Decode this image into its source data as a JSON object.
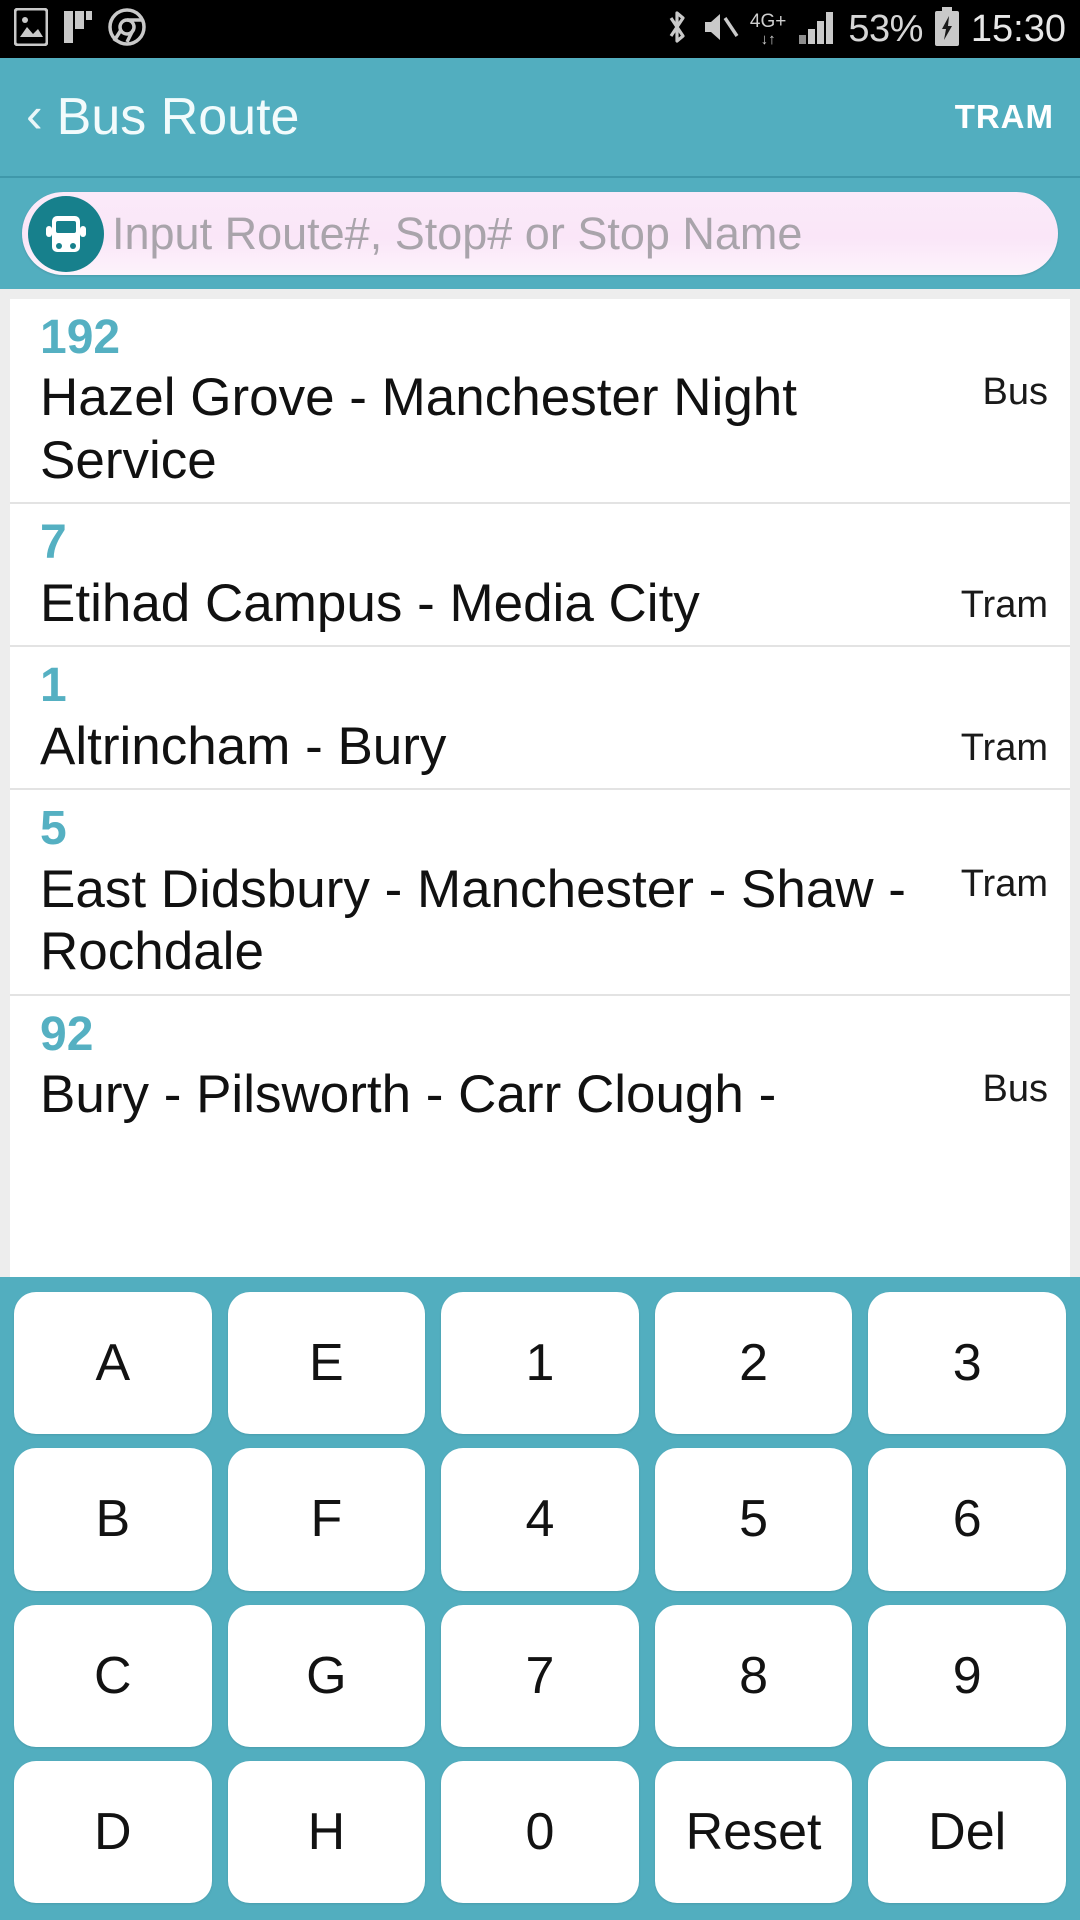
{
  "statusbar": {
    "icons_left": [
      "photo-icon",
      "flipboard-icon",
      "chrome-icon"
    ],
    "icons_right": [
      "bluetooth-icon",
      "mute-icon",
      "mobile-data-icon",
      "signal-icon",
      "battery-icon"
    ],
    "network_label": "4G+",
    "network_arrows": "↓↑",
    "battery_percent": "53%",
    "clock": "15:30"
  },
  "appbar": {
    "back_label": "‹",
    "title": "Bus Route",
    "action_label": "TRAM",
    "background": "#52aebf"
  },
  "search": {
    "icon": "bus-icon",
    "placeholder": "Input Route#, Stop# or Stop Name",
    "value": "",
    "background": "#fae6f8",
    "icon_background": "#17808c"
  },
  "routes": {
    "accent_color": "#55b0c2",
    "items": [
      {
        "number": "192",
        "name": "Hazel Grove - Manchester Night Service",
        "mode": "Bus"
      },
      {
        "number": "7",
        "name": "Etihad Campus - Media City",
        "mode": "Tram"
      },
      {
        "number": "1",
        "name": "Altrincham - Bury",
        "mode": "Tram"
      },
      {
        "number": "5",
        "name": "East Didsbury - Manchester - Shaw - Rochdale",
        "mode": "Tram"
      },
      {
        "number": "92",
        "name": "Bury - Pilsworth - Carr Clough -",
        "mode": "Bus"
      }
    ]
  },
  "keypad": {
    "background": "#52aebf",
    "rows": [
      [
        "A",
        "E",
        "1",
        "2",
        "3"
      ],
      [
        "B",
        "F",
        "4",
        "5",
        "6"
      ],
      [
        "C",
        "G",
        "7",
        "8",
        "9"
      ],
      [
        "D",
        "H",
        "0",
        "Reset",
        "Del"
      ]
    ]
  }
}
